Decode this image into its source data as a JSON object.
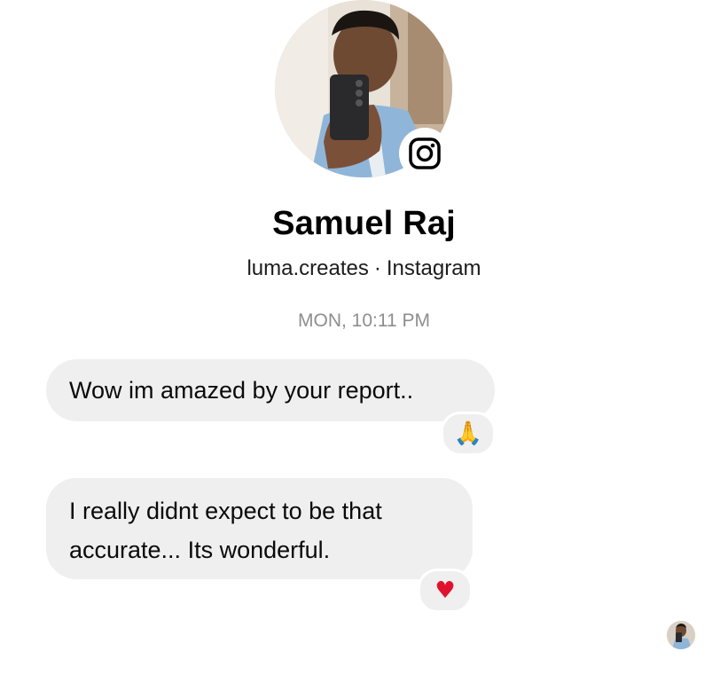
{
  "profile": {
    "name": "Samuel Raj",
    "username": "luma.creates",
    "separator": "·",
    "platform": "Instagram",
    "avatar_icon": "profile-photo",
    "badge_icon": "instagram-icon"
  },
  "timestamp": "MON, 10:11 PM",
  "messages": [
    {
      "lines": [
        "Wow im amazed by your report.."
      ],
      "reaction": "🙏",
      "reaction_icon": "folded-hands-emoji"
    },
    {
      "lines": [
        "I really didnt expect to be that",
        "accurate... Its wonderful."
      ],
      "reaction": "♥",
      "reaction_icon": "red-heart-emoji"
    }
  ],
  "seen_avatar_icon": "seen-avatar",
  "colors": {
    "bubble": "#efeff0",
    "timestamp": "#8e8e8e",
    "heart": "#e0132f"
  }
}
